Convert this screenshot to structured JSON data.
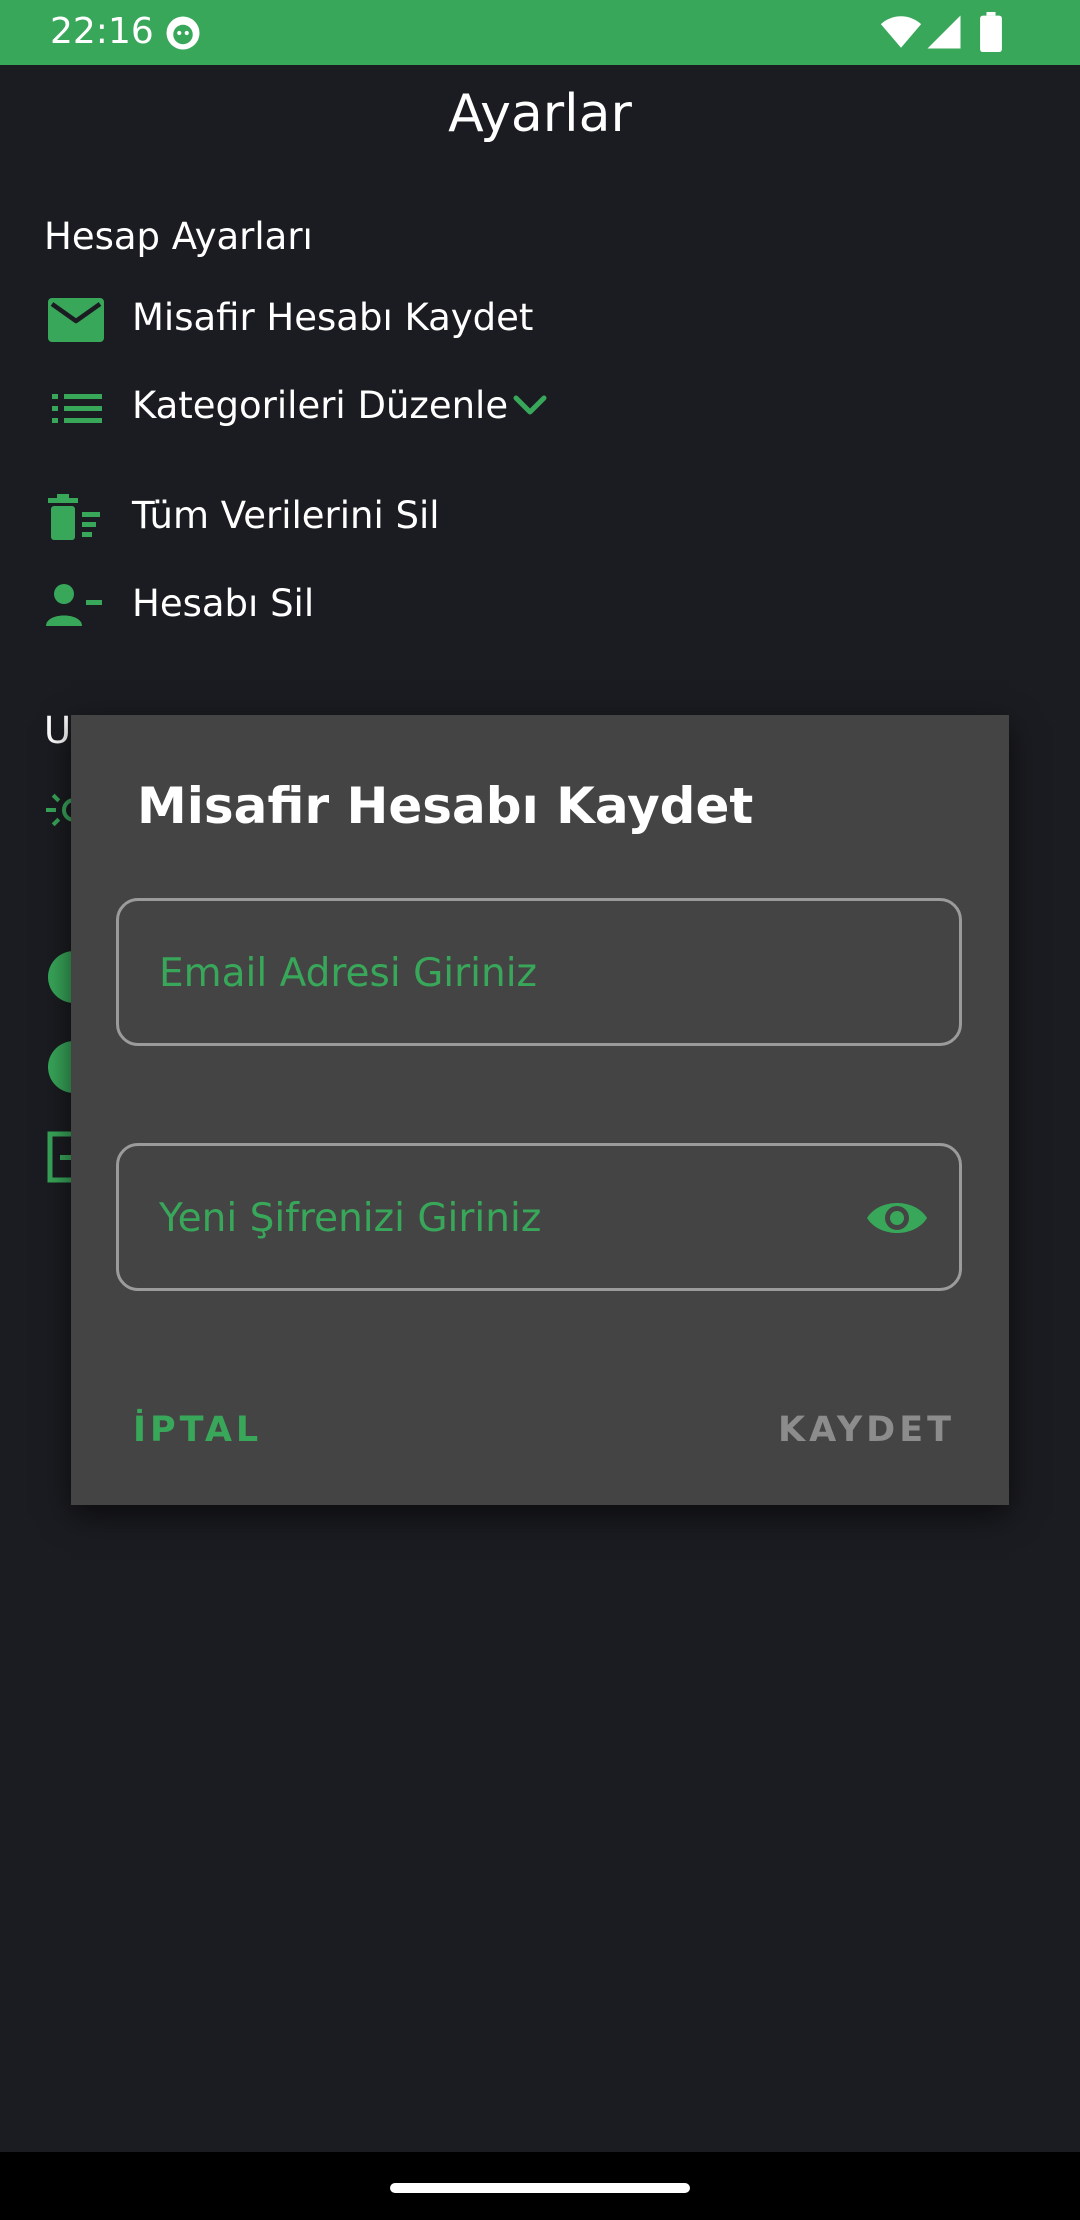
{
  "status_bar": {
    "time": "22:16",
    "color": "#38a75a"
  },
  "header": {
    "title": "Ayarlar"
  },
  "account_section": {
    "title": "Hesap Ayarları",
    "items": [
      {
        "label": "Misafir Hesabı Kaydet",
        "icon": "email-icon"
      },
      {
        "label": "Kategorileri Düzenle",
        "icon": "list-icon",
        "expand_icon": "chevron-down-icon"
      },
      {
        "label": "Tüm Verilerini Sil",
        "icon": "delete-sweep-icon"
      },
      {
        "label": "Hesabı Sil",
        "icon": "person-remove-icon"
      }
    ]
  },
  "app_section": {
    "title_partial": "U"
  },
  "dialog": {
    "title": "Misafir Hesabı Kaydet",
    "email_placeholder": "Email Adresi Giriniz",
    "password_placeholder": "Yeni Şifrenizi Giriniz",
    "password_toggle_icon": "eye-icon",
    "cancel_label": "İPTAL",
    "save_label": "KAYDET"
  },
  "colors": {
    "accent": "#38a75a",
    "background": "#1b1c21",
    "dialog": "#444444"
  }
}
